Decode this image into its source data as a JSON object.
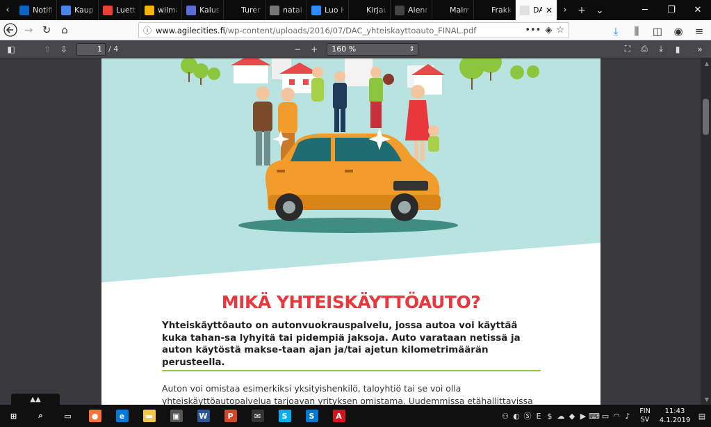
{
  "tabs": [
    {
      "title": "Notifi",
      "icon": "linkedin-icon",
      "color": "#0a66c2"
    },
    {
      "title": "Kaupu",
      "icon": "docs-icon",
      "color": "#4a86e8"
    },
    {
      "title": "Luetta",
      "icon": "photos-icon",
      "color": "#e94235"
    },
    {
      "title": "wilma",
      "icon": "wilma-icon",
      "color": "#f4b400"
    },
    {
      "title": "Kalust",
      "icon": "forms-icon",
      "color": "#5b6ed6"
    },
    {
      "title": "Turer",
      "icon": "blank-icon",
      "color": "#0c0c0d"
    },
    {
      "title": "natalie",
      "icon": "fashion-icon",
      "color": "#777"
    },
    {
      "title": "Luo H",
      "icon": "cloud-icon",
      "color": "#2d8cff"
    },
    {
      "title": "Kirjaudu",
      "icon": "blank-icon",
      "color": "#0c0c0d"
    },
    {
      "title": "Alenn",
      "icon": "grid-icon",
      "color": "#444"
    },
    {
      "title": "Malmin ha",
      "icon": "blank-icon",
      "color": "#0c0c0d"
    },
    {
      "title": "Frakk",
      "icon": "blank-icon",
      "color": "#0c0c0d"
    },
    {
      "title": "DAC_yh",
      "icon": "pdf-icon",
      "color": "#e0e0e0",
      "active": true
    }
  ],
  "url": {
    "host": "www.agilecities.fi",
    "path": "/wp-content/uploads/2016/07/DAC_yhteiskayttoauto_FINAL.pdf"
  },
  "pdf_toolbar": {
    "page_current": "1",
    "page_total": "/ 4",
    "zoom": "160 %"
  },
  "document": {
    "heading": "MIKÄ YHTEISKÄYTTÖAUTO?",
    "lead": "Yhteiskäyttöauto on autonvuokrauspalvelu, jossa autoa voi käyttää kuka tahan-sa lyhyitä tai pidempiä jaksoja. Auto varataan netissä ja auton käytöstä makse-taan ajan ja/tai ajetun kilometrimäärän perusteella.",
    "body": "Auton voi omistaa esimerkiksi yksityishenkilö, taloyhtiö tai se voi olla yhteiskäyttöautopalvelua tarjoavan yrityksen omistama. Uudemmissa etähallittavissa autoissa ovet saa auki sähköisen vara-"
  },
  "taskbar": {
    "apps": [
      {
        "name": "start-icon",
        "glyph": "⊞",
        "color": "#101010"
      },
      {
        "name": "search-icon",
        "glyph": "⌕",
        "color": "#101010"
      },
      {
        "name": "task-view-icon",
        "glyph": "▭",
        "color": "#101010"
      },
      {
        "name": "firefox-icon",
        "glyph": "●",
        "color": "#ff7139"
      },
      {
        "name": "edge-icon",
        "glyph": "e",
        "color": "#0078d7"
      },
      {
        "name": "explorer-icon",
        "glyph": "▬",
        "color": "#f2c94c"
      },
      {
        "name": "store-icon",
        "glyph": "▣",
        "color": "#555"
      },
      {
        "name": "word-icon",
        "glyph": "W",
        "color": "#2b579a"
      },
      {
        "name": "powerpoint-icon",
        "glyph": "P",
        "color": "#d24726"
      },
      {
        "name": "mail-icon",
        "glyph": "✉",
        "color": "#333"
      },
      {
        "name": "skype-icon",
        "glyph": "S",
        "color": "#00aff0"
      },
      {
        "name": "skype-business-icon",
        "glyph": "S",
        "color": "#0078d4"
      },
      {
        "name": "acrobat-icon",
        "glyph": "A",
        "color": "#d4161c"
      }
    ],
    "language": [
      "FIN",
      "SV"
    ],
    "time": "11:43",
    "date": "4.1.2019"
  }
}
